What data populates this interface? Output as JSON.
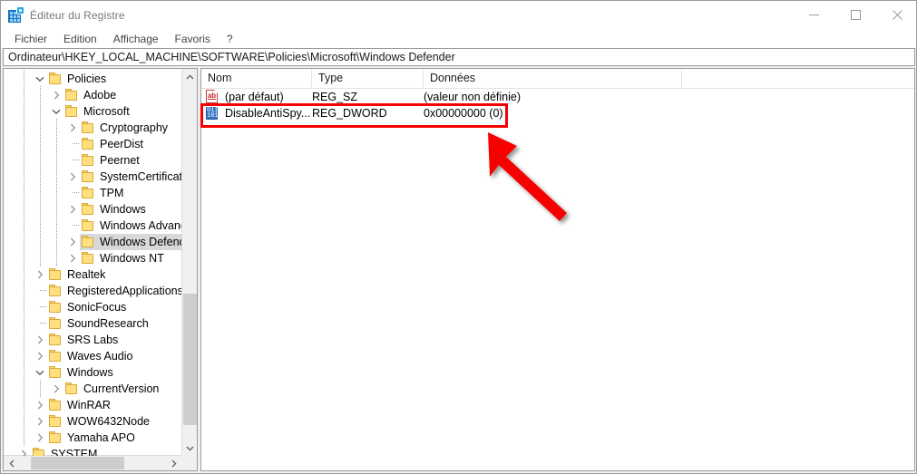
{
  "window": {
    "title": "Éditeur du Registre",
    "app_icon": "registry-editor-icon",
    "controls": {
      "minimize": "minimize-icon",
      "maximize": "maximize-icon",
      "close": "close-icon"
    }
  },
  "menu": {
    "items": [
      {
        "label": "Fichier"
      },
      {
        "label": "Edition"
      },
      {
        "label": "Affichage"
      },
      {
        "label": "Favoris"
      },
      {
        "label": "?"
      }
    ]
  },
  "address": {
    "path": "Ordinateur\\HKEY_LOCAL_MACHINE\\SOFTWARE\\Policies\\Microsoft\\Windows Defender"
  },
  "tree": {
    "items": [
      {
        "label": "Policies",
        "depth": 1,
        "state": "expanded",
        "selected": false
      },
      {
        "label": "Adobe",
        "depth": 2,
        "state": "collapsed",
        "selected": false
      },
      {
        "label": "Microsoft",
        "depth": 2,
        "state": "expanded",
        "selected": false
      },
      {
        "label": "Cryptography",
        "depth": 3,
        "state": "collapsed",
        "selected": false
      },
      {
        "label": "PeerDist",
        "depth": 3,
        "state": "leaf",
        "selected": false
      },
      {
        "label": "Peernet",
        "depth": 3,
        "state": "leaf",
        "selected": false
      },
      {
        "label": "SystemCertificates",
        "depth": 3,
        "state": "collapsed",
        "selected": false
      },
      {
        "label": "TPM",
        "depth": 3,
        "state": "leaf",
        "selected": false
      },
      {
        "label": "Windows",
        "depth": 3,
        "state": "collapsed",
        "selected": false
      },
      {
        "label": "Windows Advance",
        "depth": 3,
        "state": "leaf",
        "selected": false
      },
      {
        "label": "Windows Defender",
        "depth": 3,
        "state": "collapsed",
        "selected": true
      },
      {
        "label": "Windows NT",
        "depth": 3,
        "state": "collapsed",
        "selected": false
      },
      {
        "label": "Realtek",
        "depth": 1,
        "state": "collapsed",
        "selected": false
      },
      {
        "label": "RegisteredApplications",
        "depth": 1,
        "state": "leaf",
        "selected": false
      },
      {
        "label": "SonicFocus",
        "depth": 1,
        "state": "leaf",
        "selected": false
      },
      {
        "label": "SoundResearch",
        "depth": 1,
        "state": "leaf",
        "selected": false
      },
      {
        "label": "SRS Labs",
        "depth": 1,
        "state": "collapsed",
        "selected": false
      },
      {
        "label": "Waves Audio",
        "depth": 1,
        "state": "collapsed",
        "selected": false
      },
      {
        "label": "Windows",
        "depth": 1,
        "state": "expanded",
        "selected": false
      },
      {
        "label": "CurrentVersion",
        "depth": 2,
        "state": "collapsed",
        "selected": false
      },
      {
        "label": "WinRAR",
        "depth": 1,
        "state": "collapsed",
        "selected": false
      },
      {
        "label": "WOW6432Node",
        "depth": 1,
        "state": "collapsed",
        "selected": false
      },
      {
        "label": "Yamaha APO",
        "depth": 1,
        "state": "collapsed",
        "selected": false
      },
      {
        "label": "SYSTEM",
        "depth": 0,
        "state": "collapsed",
        "selected": false
      }
    ]
  },
  "list": {
    "columns": [
      {
        "label": "Nom"
      },
      {
        "label": "Type"
      },
      {
        "label": "Données"
      }
    ],
    "rows": [
      {
        "icon": "string-value-icon",
        "name": "(par défaut)",
        "type": "REG_SZ",
        "data": "(valeur non définie)",
        "highlighted": false
      },
      {
        "icon": "dword-value-icon",
        "name": "DisableAntiSpy...",
        "type": "REG_DWORD",
        "data": "0x00000000 (0)",
        "highlighted": true
      }
    ]
  },
  "annotations": {
    "highlight_color": "#f60000",
    "arrow_color": "#f60000",
    "highlight_target": "DisableAntiSpy... row",
    "arrow_label": "pointer-arrow"
  }
}
